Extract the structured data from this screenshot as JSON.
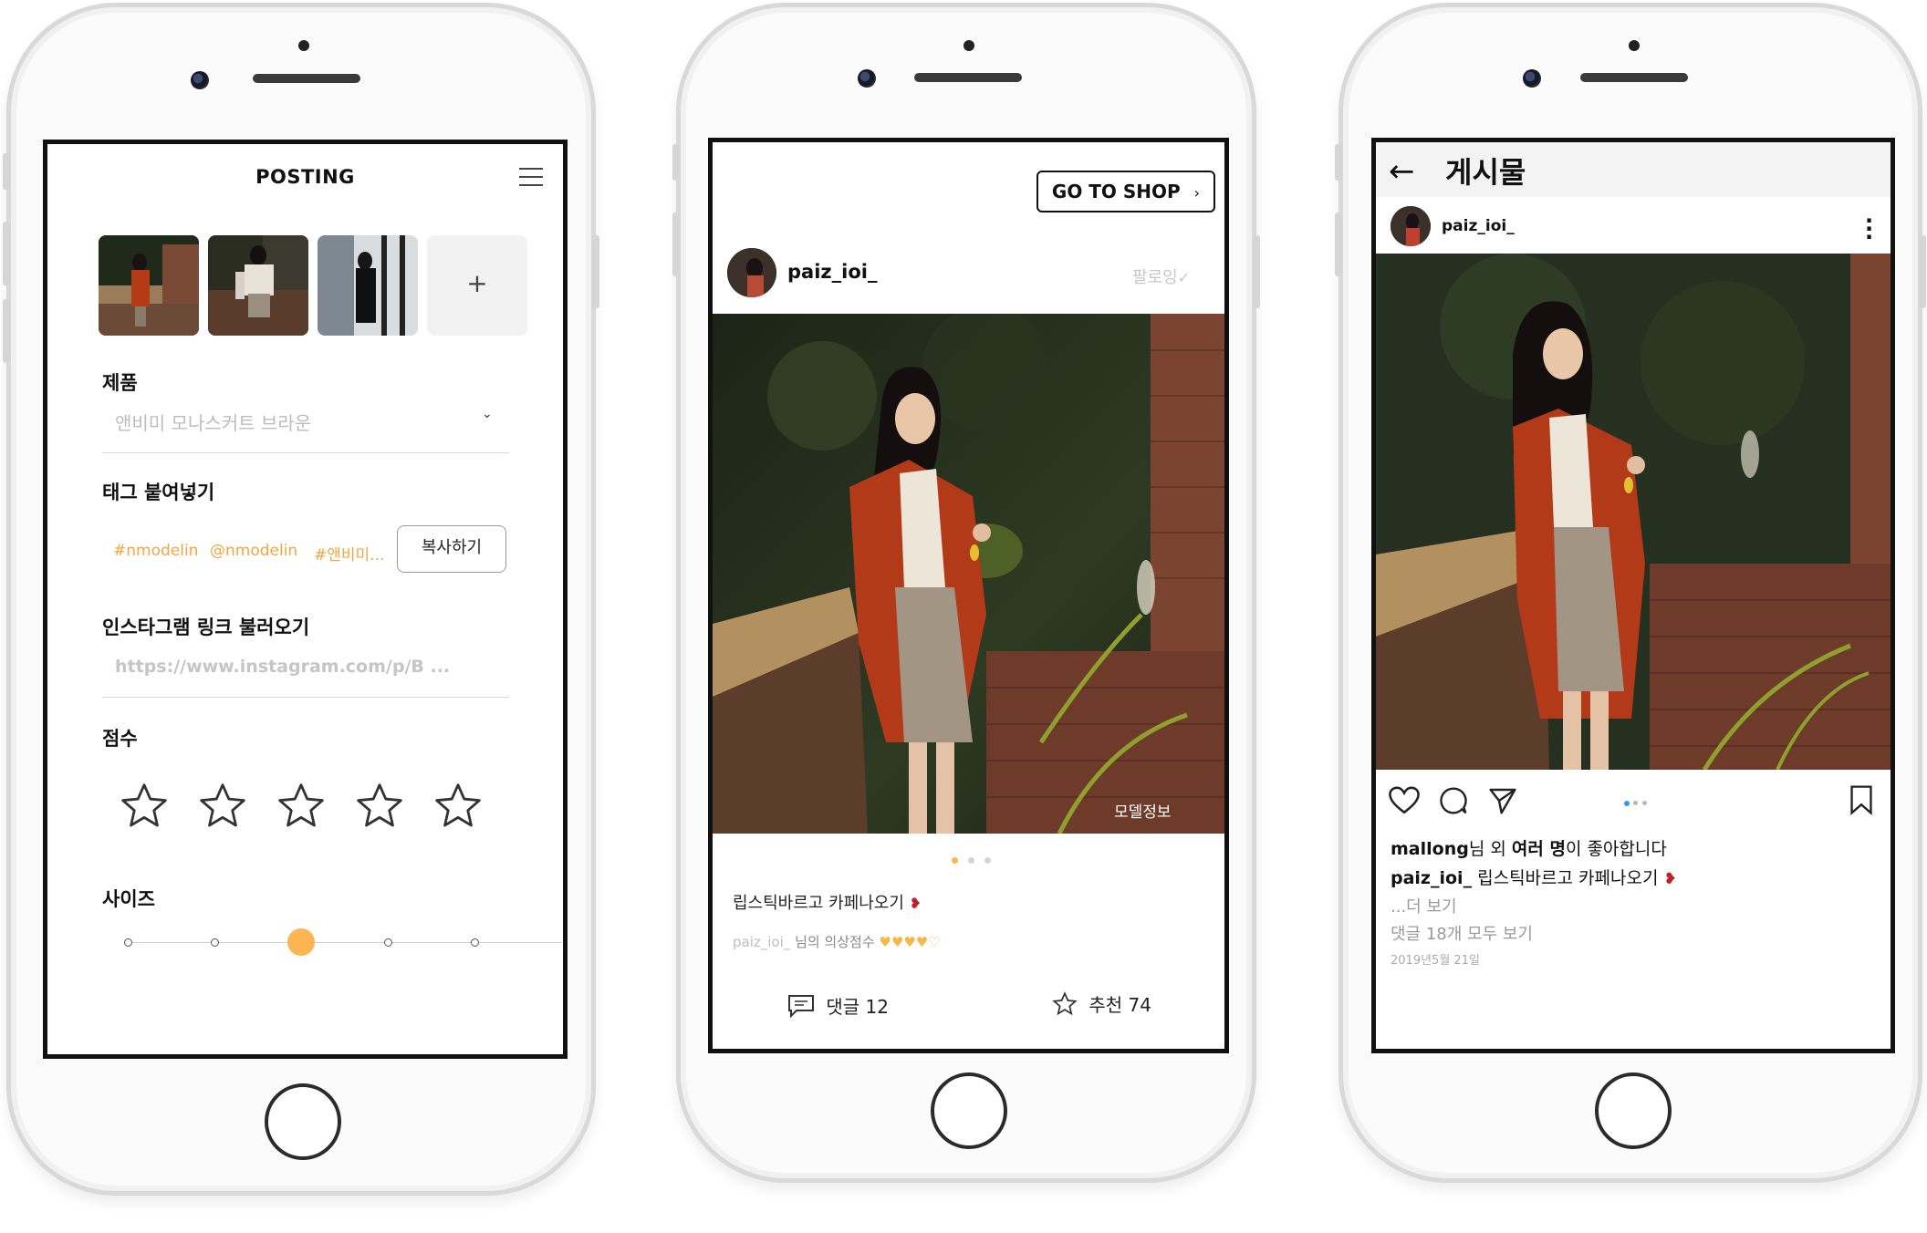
{
  "screen1": {
    "title": "POSTING",
    "add_button": "+",
    "product_label": "제품",
    "product_placeholder": "앤비미 모나스커트 브라운",
    "tags_label": "태그 붙여넣기",
    "tags": [
      "#nmodelin",
      "@nmodelin",
      "#앤비미..."
    ],
    "copy_button": "복사하기",
    "instagram_label": "인스타그램 링크 불러오기",
    "instagram_placeholder": "https://www.instagram.com/p/B ...",
    "score_label": "점수",
    "score_stars": 5,
    "size_label": "사이즈",
    "size_steps": 5,
    "size_selected_index": 2,
    "accent_color": "#fbb551"
  },
  "screen2": {
    "shop_button": "GO TO SHOP",
    "shop_chevron": "›",
    "username": "paiz_ioi_",
    "follow_label": "팔로잉",
    "model_info": "모델정보",
    "page_count": 3,
    "page_active": 0,
    "caption": "립스틱바르고 카페나오기",
    "score_user": "paiz_ioi_",
    "score_label": "님의 의상점수",
    "hearts_filled": 4,
    "hearts_total": 5,
    "comments_label": "댓글 12",
    "recommend_label": "추천 74"
  },
  "screen3": {
    "title": "게시물",
    "username": "paiz_ioi_",
    "likes_user": "mallong",
    "likes_suffix": "님 외 ",
    "likes_bold": "여러 명",
    "likes_end": "이 좋아합니다",
    "caption_user": "paiz_ioi_",
    "caption_text": " 립스틱바르고 카페나오기",
    "more_text": "...더 보기",
    "comments_text": "댓글 18개 모두 보기",
    "date_text": "2019년5월 21일",
    "page_count": 3,
    "page_active": 0,
    "accent_color": "#3897f0"
  }
}
